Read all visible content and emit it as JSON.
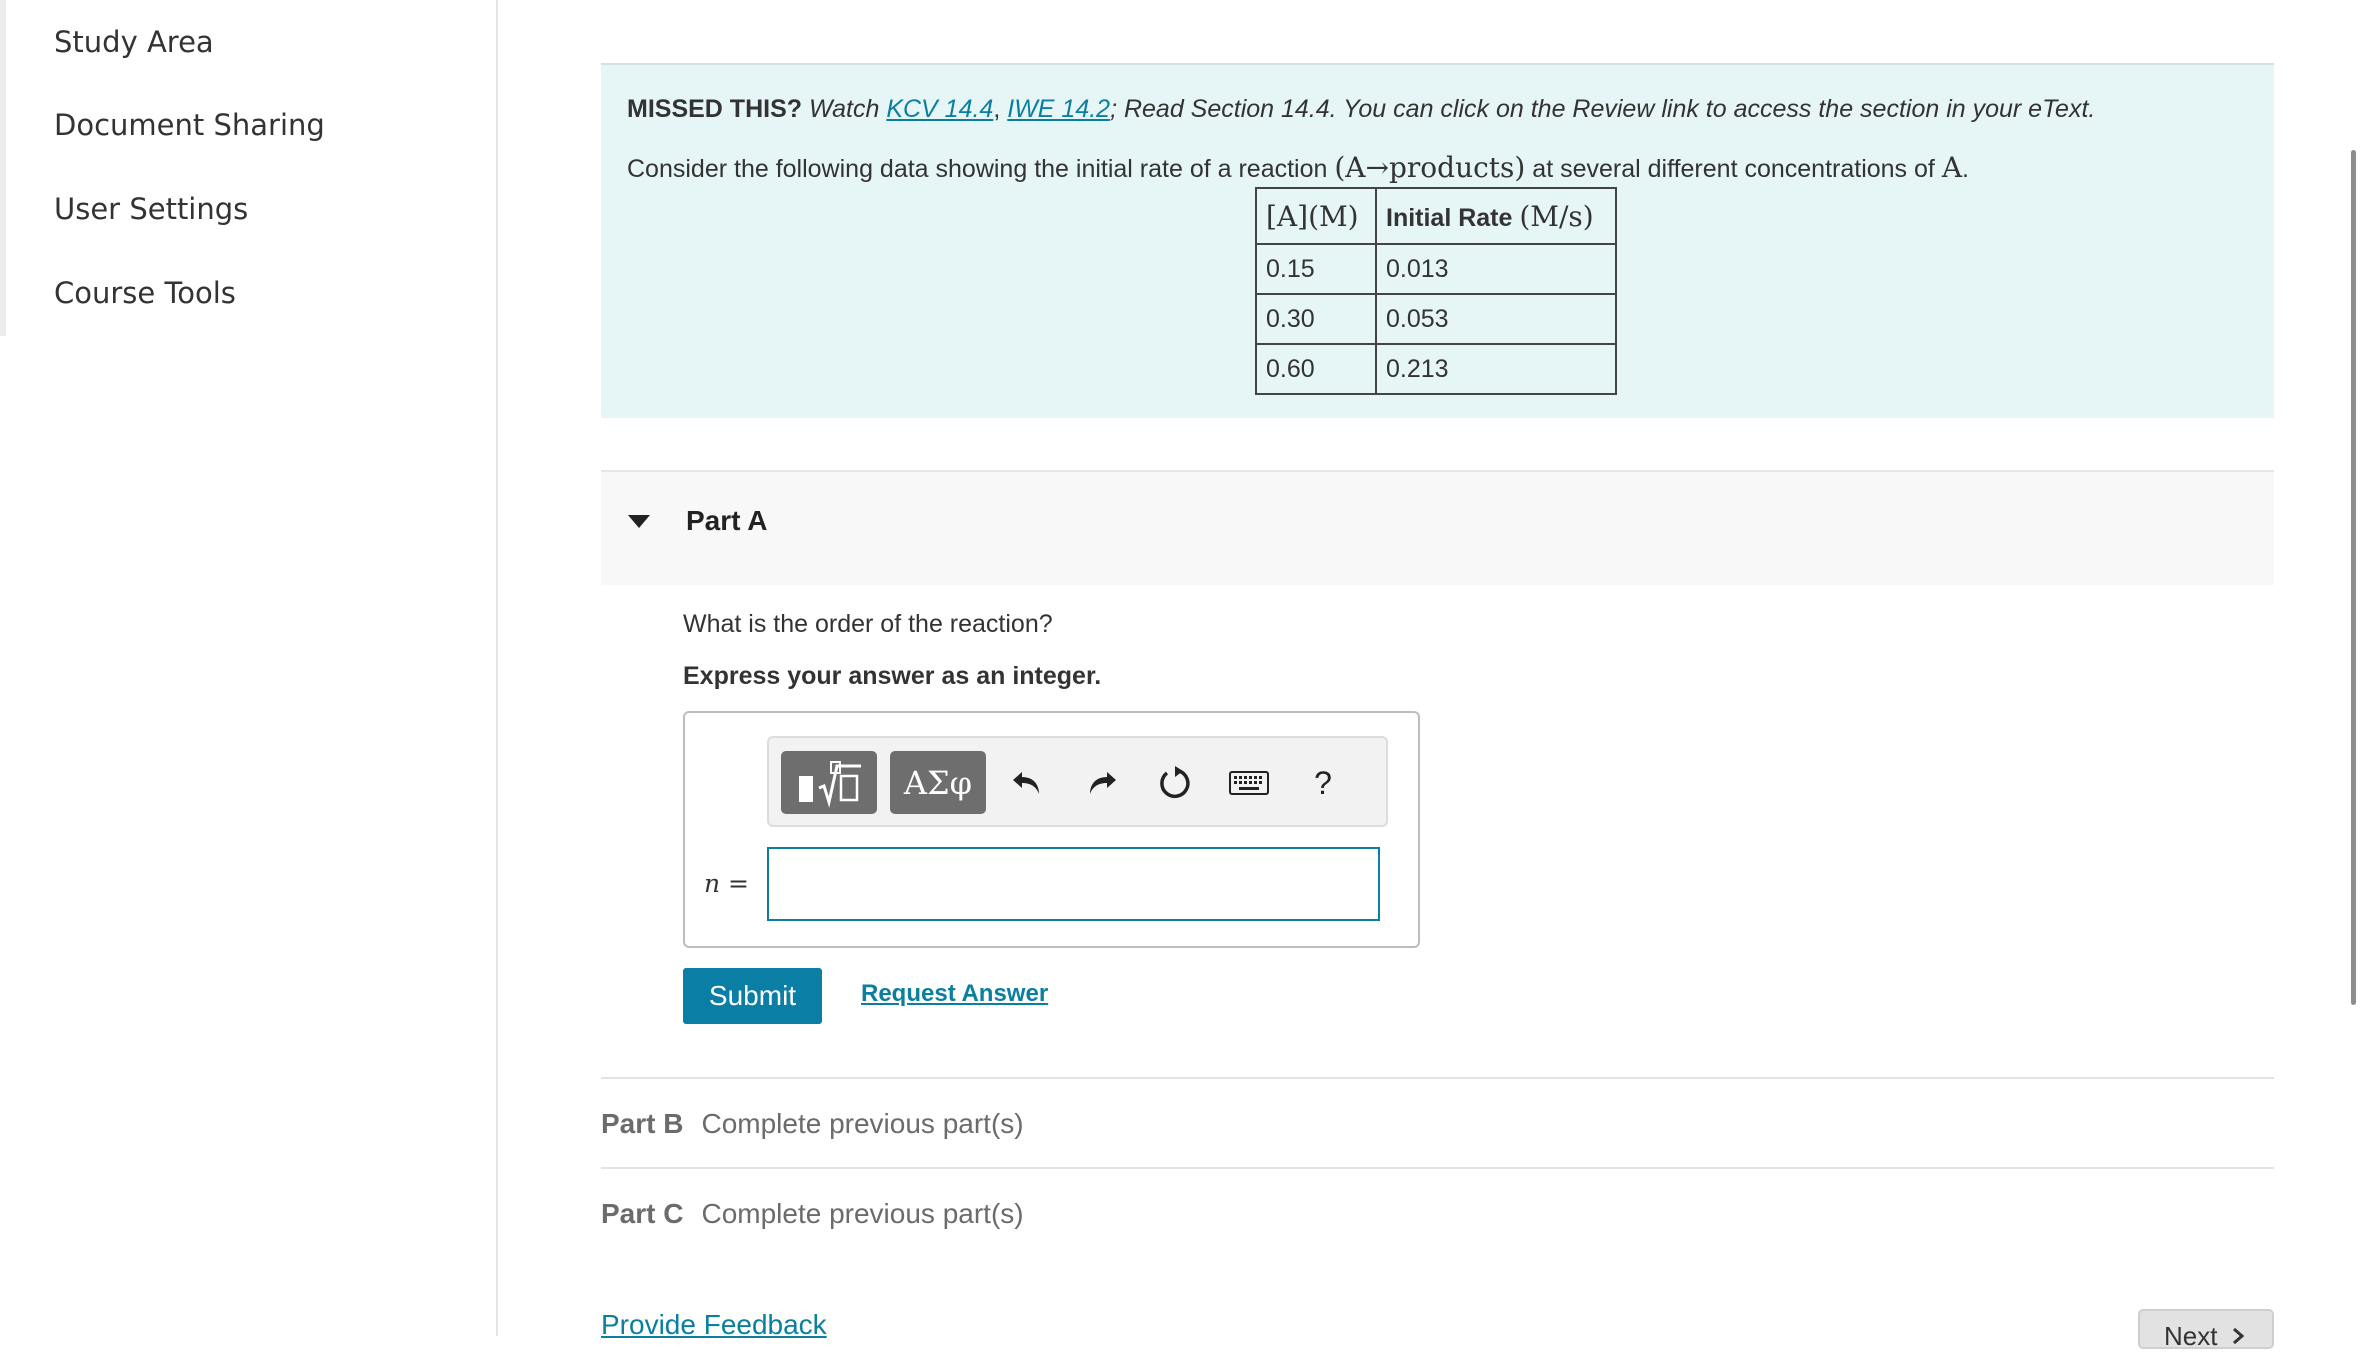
{
  "sidebar": {
    "items": [
      {
        "label": "Study Area"
      },
      {
        "label": "Document Sharing"
      },
      {
        "label": "User Settings"
      },
      {
        "label": "Course Tools"
      }
    ]
  },
  "intro": {
    "missed_label": "MISSED THIS?",
    "watch_text": "Watch",
    "link1": "KCV 14.4",
    "separator": ",",
    "link2": "IWE 14.2",
    "rest": "; Read Section 14.4. You can click on the Review link to access the section in your eText.",
    "consider_prefix": "Consider the following data showing the initial rate of a reaction",
    "reaction": "(A→products)",
    "consider_middle": "at several different concentrations of",
    "species": "A",
    "period": "."
  },
  "table": {
    "header_col1": "[A](M)",
    "header_col2_bold": "Initial Rate",
    "header_col2_unit": "(M/s)",
    "rows": [
      {
        "conc": "0.15",
        "rate": "0.013"
      },
      {
        "conc": "0.30",
        "rate": "0.053"
      },
      {
        "conc": "0.60",
        "rate": "0.213"
      }
    ]
  },
  "partA": {
    "title": "Part A",
    "question": "What is the order of the reaction?",
    "instruction": "Express your answer as an integer.",
    "variable_label": "n =",
    "answer_value": "",
    "toolbar": {
      "templates_icon": "templates-icon",
      "greek_label": "ΑΣφ",
      "undo_icon": "undo-icon",
      "redo_icon": "redo-icon",
      "reset_icon": "reset-icon",
      "keyboard_icon": "keyboard-icon",
      "help_label": "?"
    },
    "submit_label": "Submit",
    "request_label": "Request Answer"
  },
  "partB": {
    "label": "Part B",
    "status": "Complete previous part(s)"
  },
  "partC": {
    "label": "Part C",
    "status": "Complete previous part(s)"
  },
  "footer": {
    "feedback_label": "Provide Feedback",
    "next_label": "Next"
  }
}
